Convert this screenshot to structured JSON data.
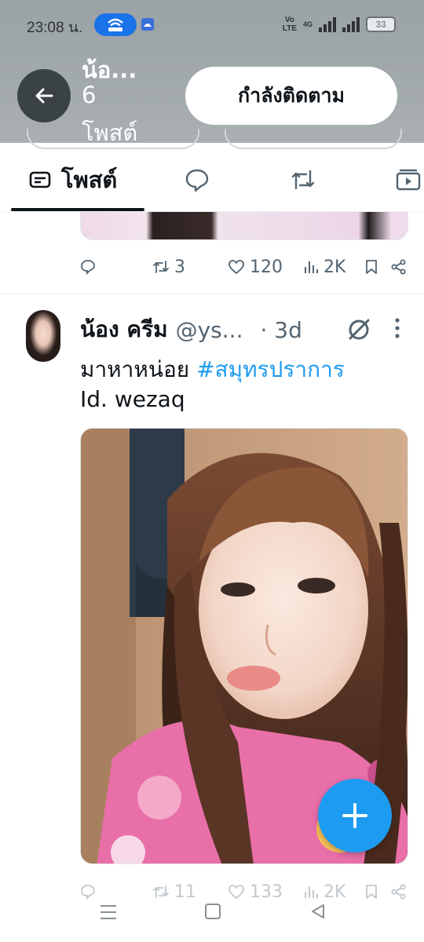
{
  "status_bar": {
    "time": "23:08 น.",
    "volte_top": "Vo",
    "volte_bottom": "LTE",
    "network": "4G",
    "battery": "33"
  },
  "header": {
    "name": "น้อ...",
    "post_count": "6",
    "post_count_label": "โพสต์",
    "follow_button": "กำลังติดตาม"
  },
  "tabs": {
    "posts_label": "โพสต์",
    "items": [
      {
        "icon": "posts-icon"
      },
      {
        "icon": "replies-icon"
      },
      {
        "icon": "reposts-icon"
      },
      {
        "icon": "media-icon"
      }
    ]
  },
  "previous_post": {
    "reposts": "3",
    "likes": "120",
    "views": "2K"
  },
  "post": {
    "author": "น้อง ครีม",
    "handle": "@ys...",
    "time": "· 3d",
    "text_line1": "มาหาหน่อย",
    "hashtag": "#สมุทรปราการ",
    "text_line2": "Id. wezaq",
    "image_icon": "selfie-photo",
    "replies": "",
    "reposts": "11",
    "likes": "133",
    "views": "2K"
  },
  "fab": {
    "icon": "plus-icon"
  },
  "colors": {
    "accent": "#1d9bf0",
    "header_band": "#9fa6a9",
    "text_primary": "#0f1419",
    "text_secondary": "#536471"
  }
}
